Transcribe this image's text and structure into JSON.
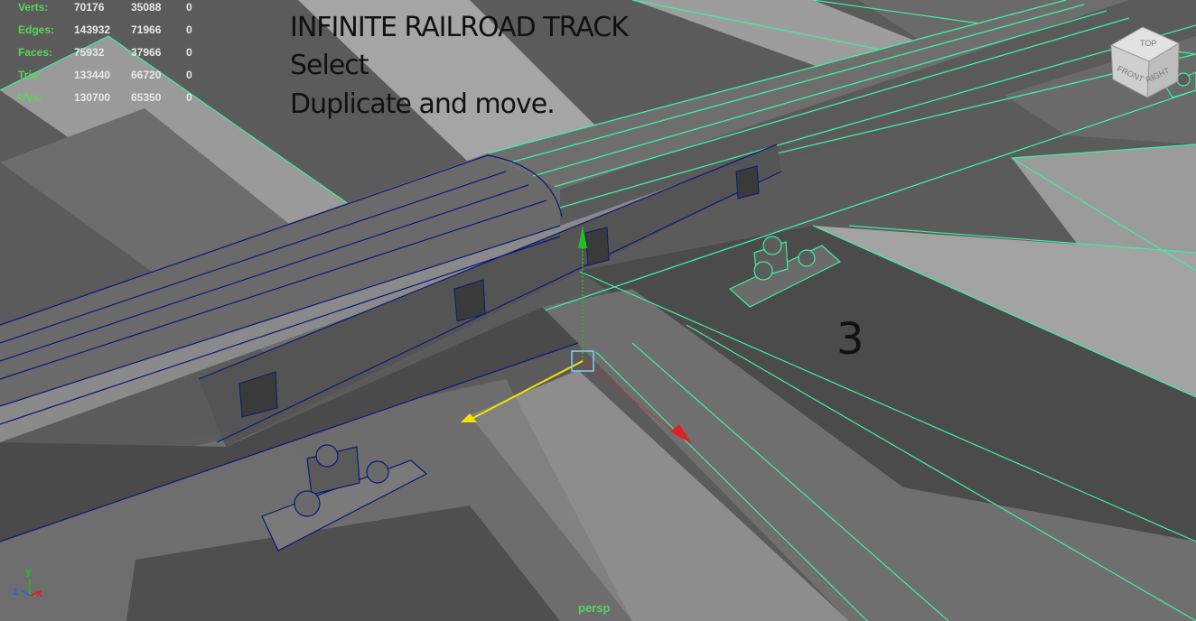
{
  "hud": {
    "rows": [
      {
        "label": "Verts:",
        "v1": "70176",
        "v2": "35088",
        "v3": "0"
      },
      {
        "label": "Edges:",
        "v1": "143932",
        "v2": "71966",
        "v3": "0"
      },
      {
        "label": "Faces:",
        "v1": "75932",
        "v2": "37966",
        "v3": "0"
      },
      {
        "label": "Tris:",
        "v1": "133440",
        "v2": "66720",
        "v3": "0"
      },
      {
        "label": "UVs:",
        "v1": "130700",
        "v2": "65350",
        "v3": "0"
      }
    ]
  },
  "caption": {
    "title": "INFINITE RAILROAD TRACK",
    "line2": "Select",
    "line3": "Duplicate and move."
  },
  "step_number": "3",
  "camera_label": "persp",
  "view_cube": {
    "top": "TOP",
    "front": "FRONT",
    "right": "RIGHT"
  },
  "axis_gizmo": {
    "x": "x",
    "y": "y",
    "z": "z"
  },
  "colors": {
    "wire_selected": "#3df0a0",
    "wire_object": "#0b1a7a",
    "hud_label": "#57d657",
    "axis_x": "#e02020",
    "axis_y": "#20c020",
    "axis_z": "#2060ff",
    "manip_yellow": "#f2e200"
  }
}
